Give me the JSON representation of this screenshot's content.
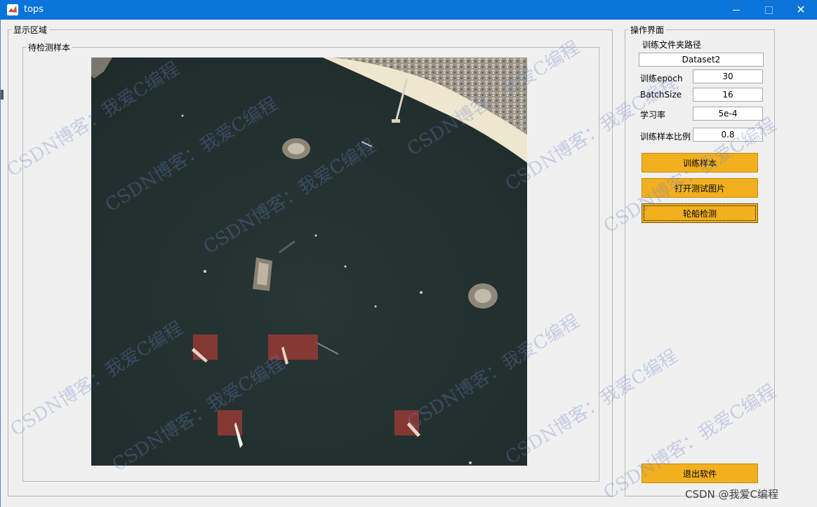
{
  "window": {
    "title": "tops",
    "icon": "matlab-icon",
    "controls": {
      "minimize": "minimize-icon",
      "maximize": "maximize-icon",
      "close": "✕"
    }
  },
  "display_panel": {
    "title": "显示区域",
    "sample_panel": {
      "title": "待检测样本"
    }
  },
  "ops_panel": {
    "title": "操作界面",
    "train_folder_label": "训练文件夹路径",
    "train_folder_value": "Dataset2",
    "fields": [
      {
        "label": "训练epoch",
        "value": "30"
      },
      {
        "label": "BatchSize",
        "value": "16"
      },
      {
        "label": "学习率",
        "value": "5e-4"
      },
      {
        "label": "训练样本比例",
        "value": "0.8"
      }
    ],
    "buttons": {
      "train": "训练样本",
      "open_test_image": "打开测试图片",
      "detect_ship": "轮船检测",
      "exit": "退出软件"
    }
  },
  "watermark": {
    "text": "CSDN博客：我爱C编程",
    "bottom_text": "CSDN @我爱C编程"
  },
  "colors": {
    "titlebar": "#0a74da",
    "button": "#f2b01f",
    "detection_box": "#a03a34",
    "sea": "#253331",
    "beach": "#efe6cf"
  }
}
